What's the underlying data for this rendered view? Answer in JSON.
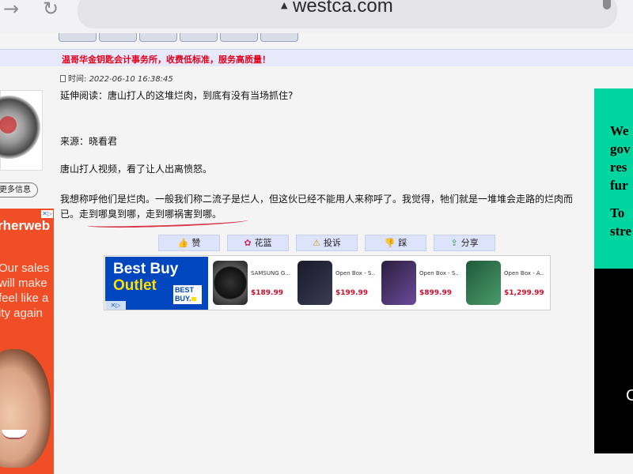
{
  "browser": {
    "url": "westca.com",
    "forward_icon": "→",
    "reload_icon": "↻",
    "lock_icon": "▲"
  },
  "banner": {
    "text": "温哥华金钥匙会计事务所，收费低标准，服务高质量！"
  },
  "post": {
    "time_label": "时间: ",
    "timestamp": "2022-06-10 16:38:45",
    "more_info": "更多信息",
    "paragraphs": [
      "延伸阅读：唐山打人的这堆烂肉，到底有没有当场抓住?",
      "来源：晓看君",
      "唐山打人视频，看了让人出离愤怒。",
      "我想称呼他们是烂肉。一般我们称二流子是烂人，但这伙已经不能用人来称呼了。我觉得，牠们就是一堆堆会走路的烂肉而已。走到哪臭到哪，走到哪祸害到哪。"
    ]
  },
  "actions": [
    {
      "icon": "👍",
      "label": "赞"
    },
    {
      "icon": "✿",
      "label": "花篮"
    },
    {
      "icon": "⚠",
      "label": "投诉"
    },
    {
      "icon": "👎",
      "label": "踩"
    },
    {
      "icon": "⇪",
      "label": "分享"
    }
  ],
  "ad_bestbuy": {
    "title_line1": "Best Buy",
    "title_line2": "Outlet",
    "logo_line1": "BEST",
    "logo_line2": "BUY.",
    "products": [
      {
        "name": "SAMSUNG G...",
        "price": "$189.99",
        "color": "#222222"
      },
      {
        "name": "Open Box - S...",
        "price": "$199.99",
        "color": "#1a1a2a"
      },
      {
        "name": "Open Box - S...",
        "price": "$899.99",
        "color": "#2a1f3d"
      },
      {
        "name": "Open Box - A...",
        "price": "$1,299.99",
        "color": "#2e6b4a"
      }
    ]
  },
  "ad_right": {
    "lines": [
      "We",
      "gov",
      "res",
      "fur"
    ],
    "lines2": [
      "To",
      "stre"
    ],
    "footer_char": "C"
  },
  "ad_left": {
    "brand": "rherweb",
    "copy": [
      "Our sales",
      "will make",
      "feel like a",
      "ity again"
    ]
  },
  "colors": {
    "banner_text": "#e0001b",
    "bestbuy_blue": "#0046be",
    "bestbuy_yellow": "#ffe000",
    "ad_green": "#00d5a0",
    "ad_orange": "#f04e27"
  }
}
